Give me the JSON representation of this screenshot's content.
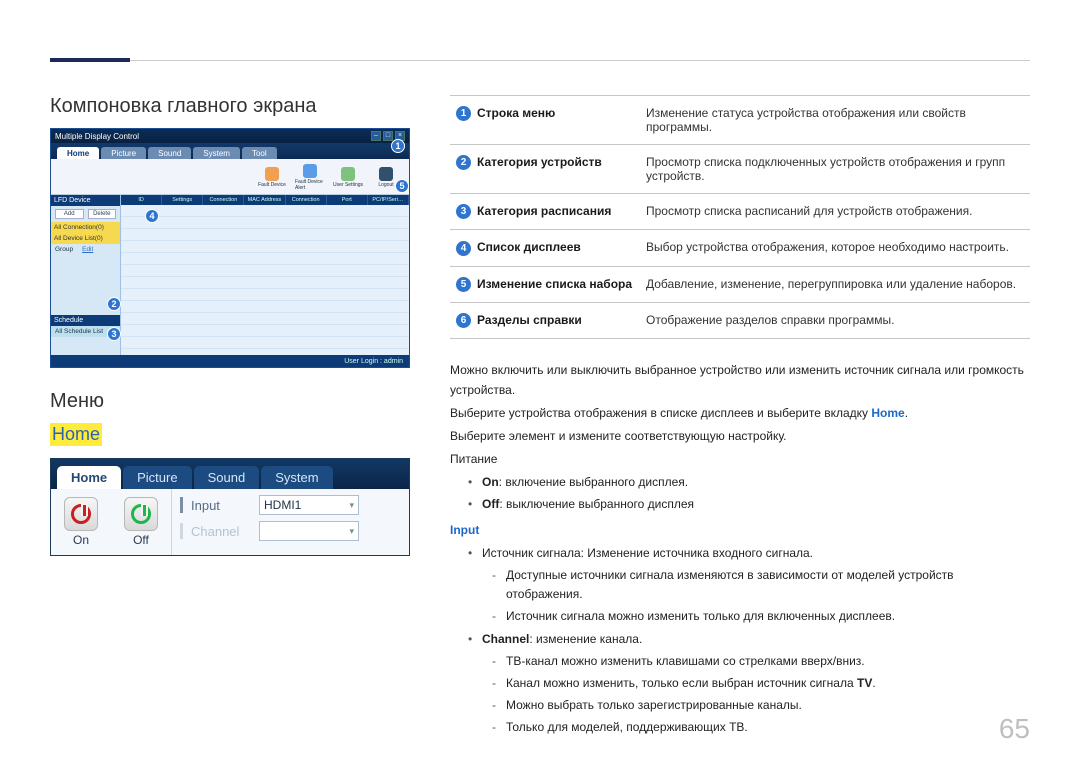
{
  "page_number": "65",
  "headings": {
    "layout": "Компоновка главного экрана",
    "menu": "Меню",
    "home": "Home"
  },
  "app": {
    "title": "Multiple Display Control",
    "tabs": [
      "Home",
      "Picture",
      "Sound",
      "System",
      "Tool"
    ],
    "toolbar": [
      {
        "label": "Fault Device"
      },
      {
        "label": "Fault Device Alert"
      },
      {
        "label": "User Settings"
      },
      {
        "label": "Logout"
      }
    ],
    "side": {
      "section1_title": "LFD Device",
      "btn_add": "Add",
      "btn_delete": "Delete",
      "all_conn_item": "All Connection(0)",
      "all_device_item": "All Device List(0)",
      "group_label": "Group",
      "group_edit": "Edit",
      "section2_title": "Schedule",
      "schedule_item": "All Schedule List"
    },
    "grid_headers": [
      "ID",
      "Settings",
      "Connection Status",
      "MAC Address",
      "Connection Type",
      "Port",
      "PC/IP/Seri…"
    ],
    "status": "User Login : admin"
  },
  "legend": [
    {
      "num": "1",
      "label": "Строка меню",
      "desc": "Изменение статуса устройства отображения или свойств программы."
    },
    {
      "num": "2",
      "label": "Категория устройств",
      "desc": "Просмотр списка подключенных устройств отображения и групп устройств."
    },
    {
      "num": "3",
      "label": "Категория расписания",
      "desc": "Просмотр списка расписаний для устройств отображения."
    },
    {
      "num": "4",
      "label": "Список дисплеев",
      "desc": "Выбор устройства отображения, которое необходимо настроить."
    },
    {
      "num": "5",
      "label": "Изменение списка набора",
      "desc": "Добавление, изменение, перегруппировка или удаление наборов."
    },
    {
      "num": "6",
      "label": "Разделы справки",
      "desc": "Отображение разделов справки программы."
    }
  ],
  "home_shot": {
    "tabs": [
      "Home",
      "Picture",
      "Sound",
      "System"
    ],
    "on_label": "On",
    "off_label": "Off",
    "input_label": "Input",
    "input_value": "HDMI1",
    "channel_label": "Channel"
  },
  "menu_text": {
    "intro1": "Можно включить или выключить выбранное устройство или изменить источник сигнала или громкость устройства.",
    "intro2_a": "Выберите устройства отображения в списке дисплеев и выберите вкладку ",
    "intro2_b": "Home",
    "intro2_c": ".",
    "intro3": "Выберите элемент и измените соответствующую настройку.",
    "power_title": "Питание",
    "on_kw": "On",
    "on_rest": ": включение выбранного дисплея.",
    "off_kw": "Off",
    "off_rest": ": выключение выбранного дисплея",
    "input_kw": "Input",
    "src_line": "Источник сигнала: Изменение источника входного сигнала.",
    "src_sub1": "Доступные источники сигнала изменяются в зависимости от моделей устройств отображения.",
    "src_sub2": "Источник сигнала можно изменить только для включенных дисплеев.",
    "channel_kw": "Channel",
    "channel_rest": ": изменение канала.",
    "ch_sub1": "ТВ-канал можно изменить клавишами со стрелками вверх/вниз.",
    "ch_sub2_a": "Канал можно изменить, только если выбран источник сигнала ",
    "ch_sub2_b": "TV",
    "ch_sub2_c": ".",
    "ch_sub3": "Можно выбрать только зарегистрированные каналы.",
    "ch_sub4": "Только для моделей, поддерживающих ТВ."
  },
  "badges": {
    "b1": "1",
    "b2": "2",
    "b3": "3",
    "b4": "4",
    "b5": "5",
    "b6": "6"
  }
}
